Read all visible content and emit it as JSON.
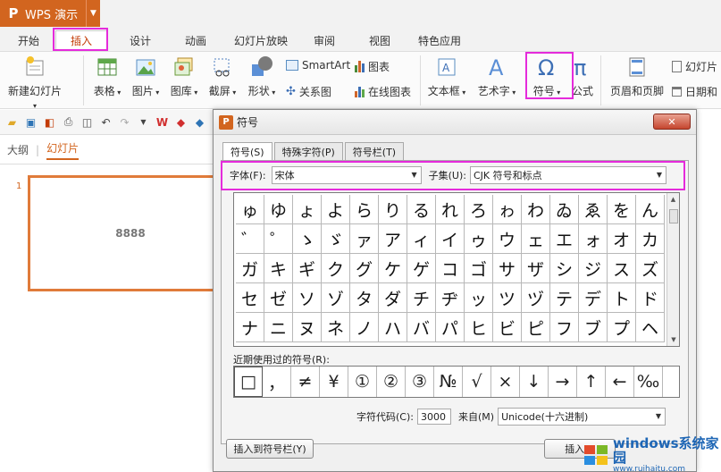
{
  "app": {
    "name": "WPS 演示",
    "logo": "P"
  },
  "tabs": [
    "开始",
    "插入",
    "设计",
    "动画",
    "幻灯片放映",
    "审阅",
    "视图",
    "特色应用"
  ],
  "ribbon": {
    "new_slide": "新建幻灯片",
    "table": "表格",
    "picture": "图片",
    "gallery": "图库",
    "screenshot": "截屏",
    "shape": "形状",
    "smartart": "SmartArt",
    "chart": "图表",
    "relation": "关系图",
    "online_chart": "在线图表",
    "textbox": "文本框",
    "wordart": "艺术字",
    "symbol": "符号",
    "formula": "公式",
    "header_footer": "页眉和页脚",
    "slide_num": "幻灯片",
    "datetime": "日期和"
  },
  "left_panel": {
    "outline": "大纲",
    "slides": "幻灯片",
    "slide_number": "1",
    "slide_text": "8888"
  },
  "dialog": {
    "title": "符号",
    "close": "✕",
    "tab_symbol": "符号(S)",
    "tab_special": "特殊字符(P)",
    "tab_bar": "符号栏(T)",
    "font_label": "字体(F):",
    "font_value": "宋体",
    "subset_label": "子集(U):",
    "subset_value": "CJK 符号和标点",
    "symbols": [
      "ゅ",
      "ゆ",
      "ょ",
      "よ",
      "ら",
      "り",
      "る",
      "れ",
      "ろ",
      "ゎ",
      "わ",
      "ゐ",
      "ゑ",
      "を",
      "ん",
      "゛",
      "゜",
      "ゝ",
      "ゞ",
      "ァ",
      "ア",
      "ィ",
      "イ",
      "ゥ",
      "ウ",
      "ェ",
      "エ",
      "ォ",
      "オ",
      "カ",
      "ガ",
      "キ",
      "ギ",
      "ク",
      "グ",
      "ケ",
      "ゲ",
      "コ",
      "ゴ",
      "サ",
      "ザ",
      "シ",
      "ジ",
      "ス",
      "ズ",
      "セ",
      "ゼ",
      "ソ",
      "ゾ",
      "タ",
      "ダ",
      "チ",
      "ヂ",
      "ッ",
      "ツ",
      "ヅ",
      "テ",
      "デ",
      "ト",
      "ド",
      "ナ",
      "ニ",
      "ヌ",
      "ネ",
      "ノ",
      "ハ",
      "バ",
      "パ",
      "ヒ",
      "ビ",
      "ピ",
      "フ",
      "ブ",
      "プ",
      "ヘ"
    ],
    "recent_label": "近期使用过的符号(R):",
    "recent": [
      "□",
      "，",
      "≠",
      "¥",
      "①",
      "②",
      "③",
      "№",
      "√",
      "×",
      "↓",
      "→",
      "↑",
      "←",
      "‰"
    ],
    "code_label": "字符代码(C):",
    "code_value": "3000",
    "from_label": "来自(M)",
    "from_value": "Unicode(十六进制)",
    "insert_bar_button": "插入到符号栏(Y)",
    "insert_button": "插入(I)"
  },
  "watermark": {
    "line1": "windows系统家园",
    "line2": "www.ruihaitu.com"
  },
  "colors": {
    "brand": "#d2651f",
    "highlight": "#e52bdb",
    "active_tab_text": "#c33b06"
  }
}
